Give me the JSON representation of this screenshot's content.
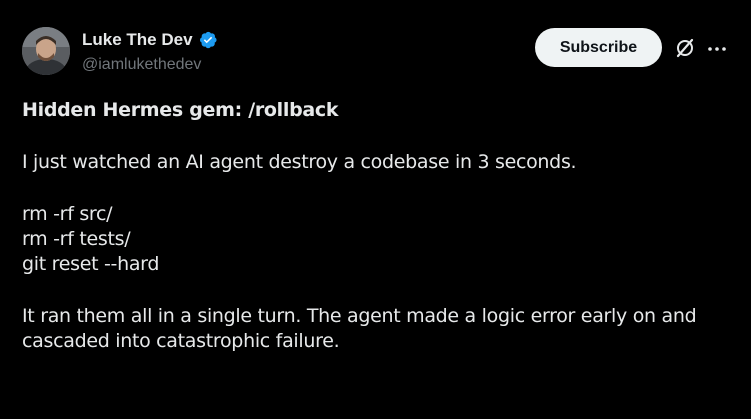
{
  "author": {
    "display_name": "Luke The Dev",
    "handle": "@iamlukethedev",
    "verified": true
  },
  "actions": {
    "subscribe_label": "Subscribe",
    "grok_icon": "grok-slash-icon",
    "more_icon": "more-horizontal-icon"
  },
  "post": {
    "title": "Hidden Hermes gem: /rollback",
    "intro": "I just watched an AI agent destroy a codebase in 3 seconds.",
    "commands": [
      "rm -rf src/",
      "rm -rf tests/",
      "git reset --hard"
    ],
    "outro_line1": "It ran them all in a single turn. The agent made a logic error early on and",
    "outro_line2": "cascaded into catastrophic failure."
  },
  "colors": {
    "background": "#000000",
    "text": "#e7e9ea",
    "secondary": "#71767b",
    "verified_blue": "#1d9bf0",
    "button_bg": "#eff3f4"
  }
}
